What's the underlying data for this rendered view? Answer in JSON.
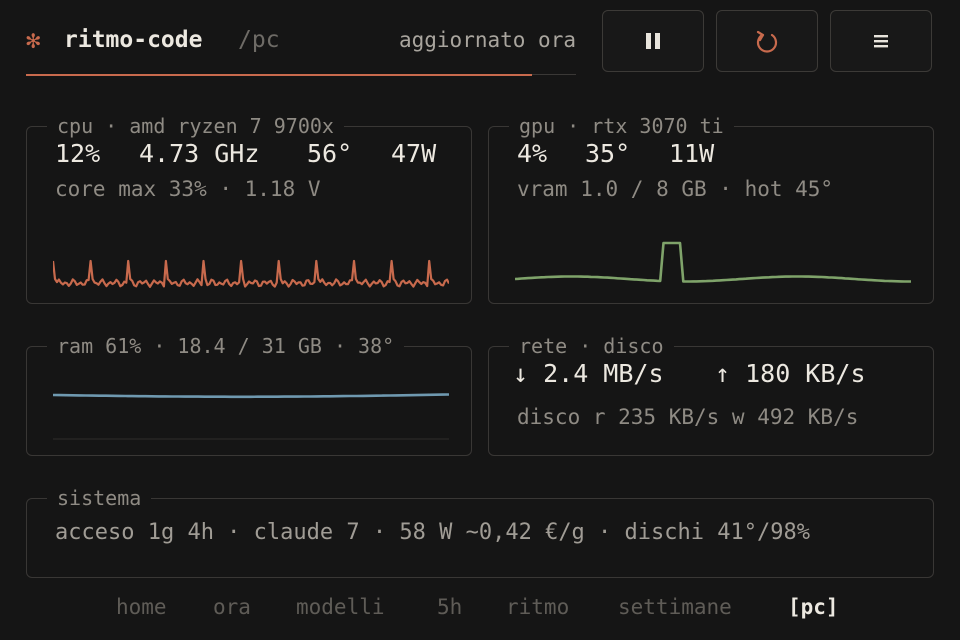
{
  "header": {
    "logo_glyph": "✻",
    "title": "ritmo-code",
    "path": "/pc",
    "status": "aggiornato ora",
    "progress": 0.92,
    "accent": "#c86a4d"
  },
  "toolbar": {
    "pause_icon": "pause-icon",
    "refresh_icon": "refresh-icon",
    "menu_icon": "menu-icon"
  },
  "cpu": {
    "legend": "cpu · amd ryzen 7 9700x",
    "usage": "12%",
    "clock": "4.73 GHz",
    "temp": "56°",
    "power": "47W",
    "sub": "core max 33% · 1.18 V",
    "color": "#c86a4d"
  },
  "gpu": {
    "legend": "gpu · rtx 3070 ti",
    "usage": "4%",
    "temp": "35°",
    "power": "11W",
    "sub": "vram 1.0 / 8 GB · hot 45°",
    "color": "#7fa36a"
  },
  "ram": {
    "legend": "ram 61% · 18.4 / 31 GB · 38°",
    "color": "#6f99b0"
  },
  "net": {
    "legend": "rete · disco",
    "down": "↓ 2.4 MB/s",
    "up": "↑ 180 KB/s",
    "disk": "disco r 235 KB/s w 492 KB/s"
  },
  "system": {
    "legend": "sistema",
    "line": "acceso 1g 4h · claude 7 · 58 W ~0,42 €/g · dischi 41°/98%"
  },
  "nav": {
    "items": [
      "home",
      "ora",
      "modelli",
      "5h",
      "ritmo",
      "settimane",
      "[pc]"
    ],
    "active": 6
  }
}
